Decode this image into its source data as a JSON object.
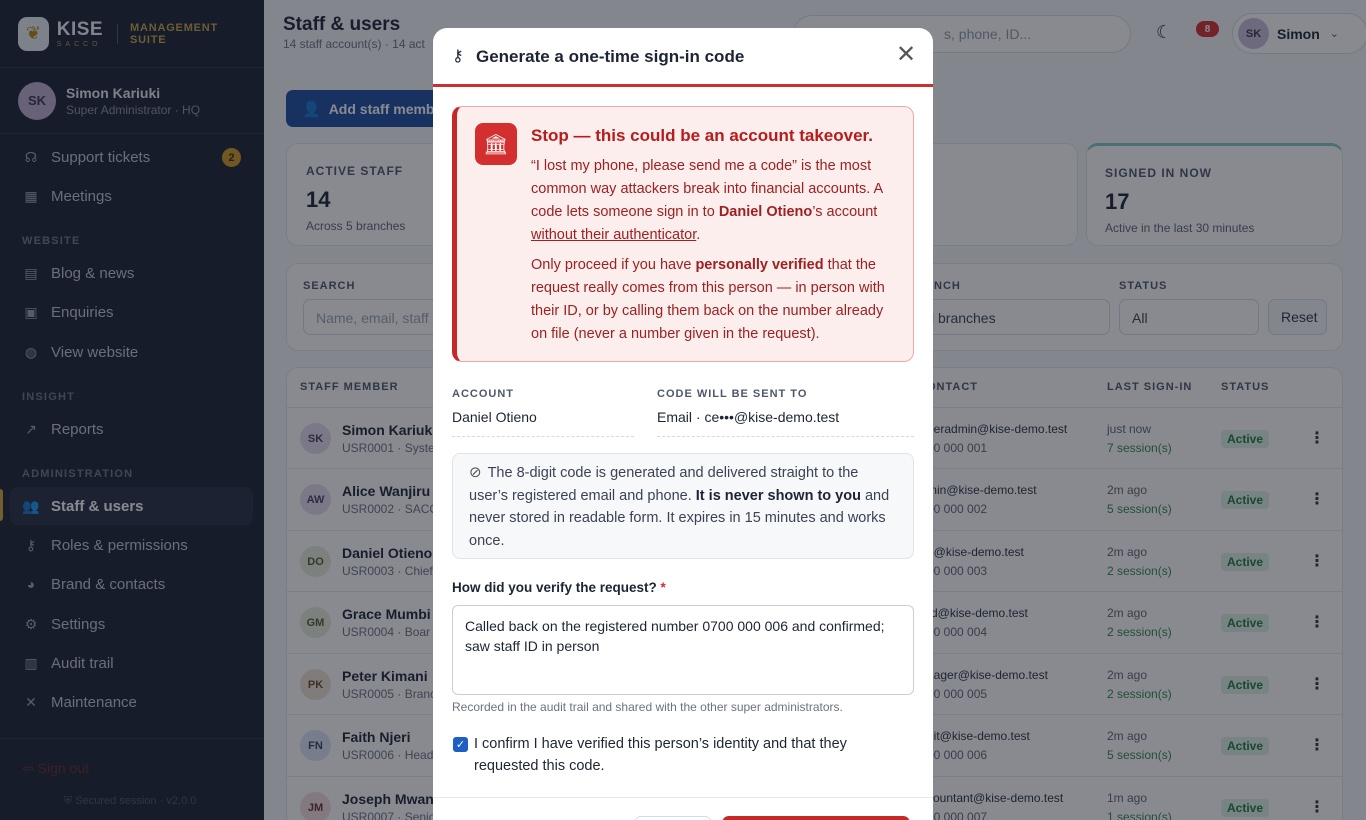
{
  "sidebar": {
    "brand": {
      "name": "KISE",
      "sub": "SACCO",
      "suite": "MANAGEMENT SUITE"
    },
    "user": {
      "initials": "SK",
      "name": "Simon Kariuki",
      "role": "Super Administrator · HQ"
    },
    "items": [
      {
        "label": "Support tickets",
        "icon": "headset-icon",
        "badge": "2"
      },
      {
        "label": "Meetings",
        "icon": "calendar-icon"
      },
      {
        "label": "Blog & news",
        "icon": "newspaper-icon"
      },
      {
        "label": "Enquiries",
        "icon": "inbox-icon"
      },
      {
        "label": "View website",
        "icon": "globe-icon"
      },
      {
        "label": "Reports",
        "icon": "chart-icon"
      },
      {
        "label": "Staff & users",
        "icon": "users-icon",
        "active": true
      },
      {
        "label": "Roles & permissions",
        "icon": "key-icon"
      },
      {
        "label": "Brand & contacts",
        "icon": "palette-icon"
      },
      {
        "label": "Settings",
        "icon": "gear-icon"
      },
      {
        "label": "Audit trail",
        "icon": "clipboard-icon"
      },
      {
        "label": "Maintenance",
        "icon": "tools-icon"
      }
    ],
    "sections": {
      "website": "WEBSITE",
      "insight": "INSIGHT",
      "administration": "ADMINISTRATION"
    },
    "signout": "Sign out",
    "secured": "Secured session · v2.0.0"
  },
  "header": {
    "title": "Staff & users",
    "subtitle": "14 staff account(s) · 14 act",
    "search_placeholder": "s, phone, ID...",
    "notifications": "8",
    "user_initials": "SK",
    "user_name": "Simon"
  },
  "toolbar": {
    "add_label": "Add staff membe"
  },
  "stats": [
    {
      "label": "ACTIVE STAFF",
      "value": "14",
      "sub": "Across 5 branches"
    },
    {
      "label": "SIGNED IN NOW",
      "value": "17",
      "sub": "Active in the last 30 minutes"
    }
  ],
  "filters": {
    "search_label": "SEARCH",
    "search_placeholder": "Name, email, staff",
    "branch_label": "NCH",
    "branch_value": "l branches",
    "status_label": "STATUS",
    "status_value": "All",
    "reset_label": "Reset"
  },
  "table": {
    "headers": {
      "member": "STAFF MEMBER",
      "contact": "ONTACT",
      "last": "LAST SIGN-IN",
      "status": "STATUS"
    },
    "rows": [
      {
        "initials": "SK",
        "name": "Simon Kariuki",
        "id": "USR0001 · Syste",
        "email": "peradmin@kise-demo.test",
        "phone": "00 000 001",
        "last": "just now",
        "sessions": "7 session(s)",
        "status": "Active",
        "avbg": "#e4ddef",
        "avfg": "#4c3f63"
      },
      {
        "initials": "AW",
        "name": "Alice Wanjiru",
        "id": "USR0002 · SACC",
        "email": "min@kise-demo.test",
        "phone": "00 000 002",
        "last": "2m ago",
        "sessions": "5 session(s)",
        "status": "Active",
        "avbg": "#e4ddef",
        "avfg": "#4c3f63"
      },
      {
        "initials": "DO",
        "name": "Daniel Otieno",
        "id": "USR0003 · Chief",
        "email": "o@kise-demo.test",
        "phone": "00 000 003",
        "last": "2m ago",
        "sessions": "2 session(s)",
        "status": "Active",
        "avbg": "#e7ecd8",
        "avfg": "#535f2e"
      },
      {
        "initials": "GM",
        "name": "Grace Mumbi",
        "id": "USR0004 · Boar",
        "email": "rd@kise-demo.test",
        "phone": "00 000 004",
        "last": "2m ago",
        "sessions": "2 session(s)",
        "status": "Active",
        "avbg": "#e7ecd8",
        "avfg": "#535f2e"
      },
      {
        "initials": "PK",
        "name": "Peter Kimani",
        "id": "USR0005 · Branc",
        "email": "nager@kise-demo.test",
        "phone": "00 000 005",
        "last": "2m ago",
        "sessions": "2 session(s)",
        "status": "Active",
        "avbg": "#f1e3d6",
        "avfg": "#6d4a2a"
      },
      {
        "initials": "FN",
        "name": "Faith Njeri",
        "id": "USR0006 · Head",
        "email": "dit@kise-demo.test",
        "phone": "00 000 006",
        "last": "2m ago",
        "sessions": "5 session(s)",
        "status": "Active",
        "avbg": "#dde4f2",
        "avfg": "#34456b"
      },
      {
        "initials": "JM",
        "name": "Joseph Mwan",
        "id": "USR0007 · Senio",
        "email": "countant@kise-demo.test",
        "phone": "00 000 007",
        "last": "1m ago",
        "sessions": "1 session(s)",
        "status": "Active",
        "avbg": "#f3dede",
        "avfg": "#6b2f2f"
      }
    ]
  },
  "modal": {
    "title": "Generate a one-time sign-in code",
    "warning": {
      "title": "Stop — this could be an account takeover.",
      "p1_a": "“I lost my phone, please send me a code” is the most common way attackers break into financial accounts. A code lets someone sign in to ",
      "p1_name": "Daniel Otieno",
      "p1_b": "’s account ",
      "p1_u": "without their authenticator",
      "p1_c": ".",
      "p2_a": "Only proceed if you have ",
      "p2_b": "personally verified",
      "p2_c": " that the request really comes from this person — in person with their ID, or by calling them back on the number already on file (never a number given in the request)."
    },
    "account_label": "ACCOUNT",
    "account_value": "Daniel Otieno",
    "sendto_label": "CODE WILL BE SENT TO",
    "sendto_value": "Email · ce•••@kise-demo.test",
    "info_a": "The 8-digit code is generated and delivered straight to the user’s registered email and phone. ",
    "info_b": "It is never shown to you",
    "info_c": " and never stored in readable form. It expires in 15 minutes and works once.",
    "verify_label": "How did you verify the request?",
    "verify_required": "*",
    "verify_value": "Called back on the registered number 0700 000 006 and confirmed; saw staff ID in person",
    "help": "Recorded in the audit trail and shared with the other super administrators.",
    "confirm_label": "I confirm I have verified this person’s identity and that they requested this code.",
    "confirm_checked": true
  }
}
